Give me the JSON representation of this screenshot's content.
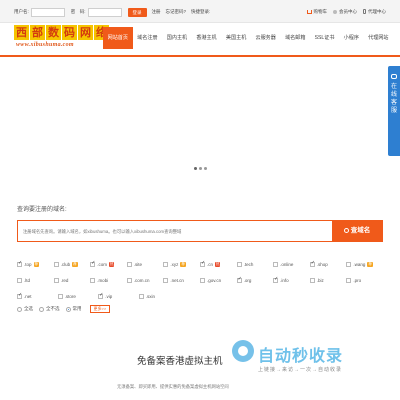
{
  "topbar": {
    "username_label": "用户名:",
    "password_label": "密　码:",
    "login_button": "登录",
    "register_link": "注册",
    "forgot_link": "忘记密码?",
    "quick_login": "快捷登录:",
    "cart": "购物车",
    "member_center": "会员中心",
    "agent_center": "代理中心"
  },
  "logo": {
    "main_chars": [
      "西",
      "部",
      "数",
      "码",
      "网",
      "络"
    ],
    "url_text": "www.xibushuma.com"
  },
  "nav": {
    "items": [
      {
        "label": "网站首页",
        "active": true
      },
      {
        "label": "域名注册",
        "active": false
      },
      {
        "label": "国内主机",
        "active": false
      },
      {
        "label": "香港主机",
        "active": false
      },
      {
        "label": "美国主机",
        "active": false
      },
      {
        "label": "云服务器",
        "active": false
      },
      {
        "label": "域名邮箱",
        "active": false
      },
      {
        "label": "SSL证书",
        "active": false
      },
      {
        "label": "小程序",
        "active": false
      },
      {
        "label": "代理网站",
        "active": false
      }
    ]
  },
  "service": {
    "label": "在线客服"
  },
  "search": {
    "title": "查询要注册的域名:",
    "placeholder": "注册域名先查询。请输入域名，如xibushuma。也可以输入xibushuma.com查询整域",
    "button": "查域名"
  },
  "suffixes": [
    [
      {
        "name": ".top",
        "checked": true,
        "badge": "荐",
        "badge_type": "orange"
      },
      {
        "name": ".club",
        "checked": false,
        "badge": "荐",
        "badge_type": "orange"
      },
      {
        "name": ".com",
        "checked": true,
        "badge": "热",
        "badge_type": "red"
      },
      {
        "name": ".site",
        "checked": false,
        "badge": "",
        "badge_type": ""
      },
      {
        "name": ".xyz",
        "checked": false,
        "badge": "荐",
        "badge_type": "orange"
      },
      {
        "name": ".cn",
        "checked": true,
        "badge": "热",
        "badge_type": "red"
      },
      {
        "name": ".tech",
        "checked": false,
        "badge": "",
        "badge_type": ""
      },
      {
        "name": ".online",
        "checked": false,
        "badge": "",
        "badge_type": ""
      },
      {
        "name": ".shop",
        "checked": true,
        "badge": "",
        "badge_type": ""
      },
      {
        "name": ".wang",
        "checked": false,
        "badge": "荐",
        "badge_type": "orange"
      }
    ],
    [
      {
        "name": ".ltd",
        "checked": false,
        "badge": "",
        "badge_type": ""
      },
      {
        "name": ".red",
        "checked": false,
        "badge": "",
        "badge_type": ""
      },
      {
        "name": ".mobi",
        "checked": false,
        "badge": "",
        "badge_type": ""
      },
      {
        "name": ".com.cn",
        "checked": false,
        "badge": "",
        "badge_type": ""
      },
      {
        "name": ".net.cn",
        "checked": false,
        "badge": "",
        "badge_type": ""
      },
      {
        "name": ".gov.cn",
        "checked": false,
        "badge": "",
        "badge_type": ""
      },
      {
        "name": ".org",
        "checked": true,
        "badge": "",
        "badge_type": ""
      },
      {
        "name": ".info",
        "checked": true,
        "badge": "",
        "badge_type": ""
      },
      {
        "name": ".biz",
        "checked": false,
        "badge": "",
        "badge_type": ""
      },
      {
        "name": ".pro",
        "checked": false,
        "badge": "",
        "badge_type": ""
      }
    ],
    [
      {
        "name": ".net",
        "checked": true,
        "badge": "",
        "badge_type": ""
      },
      {
        "name": ".store",
        "checked": false,
        "badge": "",
        "badge_type": ""
      },
      {
        "name": ".vip",
        "checked": true,
        "badge": "",
        "badge_type": ""
      },
      {
        "name": ".sxin",
        "checked": false,
        "badge": "",
        "badge_type": ""
      }
    ]
  ],
  "select_options": {
    "all": "全选",
    "none": "全不选",
    "common": "常用",
    "selected": "common",
    "more": "更多>>"
  },
  "promo": {
    "title": "免备案香港虚拟主机",
    "subtitle": "无须备案、即买即用、提供实惠的免备案虚拟主机网站空间"
  },
  "watermark": {
    "title": "自动秒收录",
    "subtitle": "上链接→来访→一次→自动收录"
  },
  "colors": {
    "accent": "#f05a1a",
    "service_blue": "#2e7fd1",
    "logo_yellow": "#f5c400"
  }
}
